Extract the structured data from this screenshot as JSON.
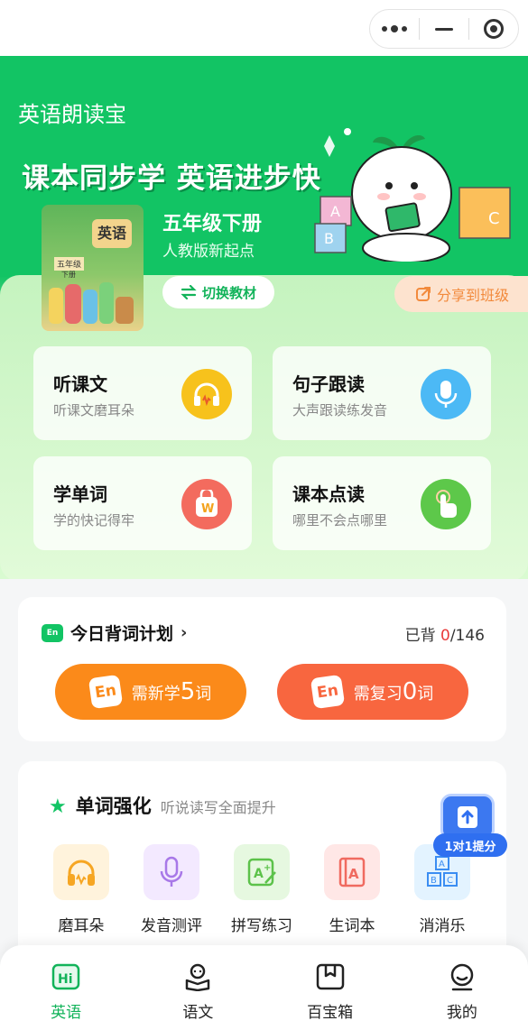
{
  "capsule": {
    "more_icon": "more-dots-icon",
    "minimize_icon": "minus-icon",
    "close_icon": "target-icon"
  },
  "hero": {
    "app_title": "英语朗读宝",
    "slogan": "课本同步学 英语进步快",
    "book": {
      "cover_title": "英语",
      "cover_grade": "五年级",
      "cover_volume": "下册",
      "name": "五年级下册",
      "publisher": "人教版新起点"
    },
    "switch_label": "切换教材",
    "share_label": "分享到班级"
  },
  "features": [
    {
      "title": "听课文",
      "subtitle": "听课文磨耳朵",
      "icon": "headphones-icon",
      "color": "#f7c21c"
    },
    {
      "title": "句子跟读",
      "subtitle": "大声跟读练发音",
      "icon": "microphone-icon",
      "color": "#4cb9f5"
    },
    {
      "title": "学单词",
      "subtitle": "学的快记得牢",
      "icon": "word-bag-icon",
      "color": "#f36b5e"
    },
    {
      "title": "课本点读",
      "subtitle": "哪里不会点哪里",
      "icon": "finger-tap-icon",
      "color": "#5dc84a"
    }
  ],
  "plan": {
    "title": "今日背词计划",
    "count_prefix": "已背 ",
    "count_done": "0",
    "count_total": "/146",
    "learn": {
      "prefix": "需新学",
      "number": "5",
      "suffix": "词",
      "badge": "En",
      "color": "#fb8a1a"
    },
    "review": {
      "prefix": "需复习",
      "number": "0",
      "suffix": "词",
      "badge": "En",
      "color": "#f8663f"
    }
  },
  "words": {
    "title": "单词强化",
    "subtitle": "听说读写全面提升",
    "items": [
      {
        "label": "磨耳朵",
        "icon": "headphones-icon"
      },
      {
        "label": "发音测评",
        "icon": "microphone-icon"
      },
      {
        "label": "拼写练习",
        "icon": "spelling-icon"
      },
      {
        "label": "生词本",
        "icon": "notebook-icon"
      },
      {
        "label": "消消乐",
        "icon": "abc-blocks-icon"
      }
    ],
    "tutor_label": "1对1提分"
  },
  "tabs": [
    {
      "label": "英语",
      "icon": "hi-icon",
      "active": true
    },
    {
      "label": "语文",
      "icon": "reading-icon",
      "active": false
    },
    {
      "label": "百宝箱",
      "icon": "box-icon",
      "active": false
    },
    {
      "label": "我的",
      "icon": "profile-icon",
      "active": false
    }
  ],
  "colors": {
    "brand_green": "#12c464",
    "accent_orange": "#f28a3c",
    "alert_red": "#e93a3a",
    "tutor_blue": "#2f6ff0"
  }
}
